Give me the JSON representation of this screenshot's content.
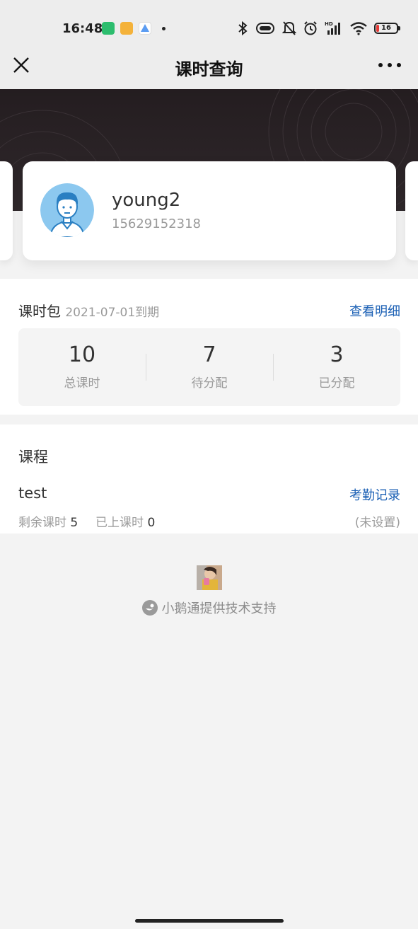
{
  "status_bar": {
    "time": "16:48",
    "battery_level": "16",
    "icons": [
      "bluetooth-icon",
      "vibrate-icon",
      "mute-bell-icon",
      "alarm-icon",
      "signal-icon",
      "wifi-icon",
      "battery-icon"
    ],
    "app_icon_colors": [
      "#2dbd6e",
      "#f4b23a",
      "#5b9cf2"
    ],
    "network_hd": "HD"
  },
  "nav": {
    "title": "课时查询",
    "close_icon": "close-icon",
    "more_icon": "more-icon"
  },
  "profile": {
    "name": "young2",
    "phone": "15629152318",
    "avatar_color": "#8cc8ef"
  },
  "package": {
    "label": "课时包",
    "expiry": "2021-07-01到期",
    "detail_link": "查看明细",
    "stats": [
      {
        "value": "10",
        "label": "总课时"
      },
      {
        "value": "7",
        "label": "待分配"
      },
      {
        "value": "3",
        "label": "已分配"
      }
    ]
  },
  "courses": {
    "title": "课程",
    "items": [
      {
        "name": "test",
        "attendance_link": "考勤记录",
        "remaining_label": "剩余课时",
        "remaining_value": "5",
        "attended_label": "已上课时",
        "attended_value": "0",
        "status": "(未设置)"
      }
    ]
  },
  "footer": {
    "brand_text": "小鹅通提供技术支持"
  },
  "colors": {
    "accent_link": "#1a5fb4",
    "banner_dark": "#2a2326",
    "page_bg": "#f3f3f3"
  }
}
